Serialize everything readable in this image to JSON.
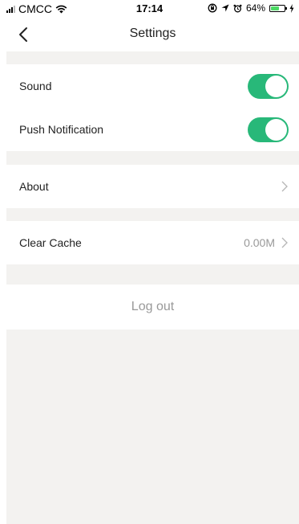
{
  "status_bar": {
    "carrier": "CMCC",
    "time": "17:14",
    "battery_percent": "64%",
    "battery_level": 0.64,
    "icons": [
      "signal-icon",
      "wifi-icon",
      "lock-rotation-icon",
      "location-icon",
      "alarm-icon",
      "battery-icon",
      "charging-icon"
    ]
  },
  "nav": {
    "title": "Settings",
    "back_icon": "chevron-left-icon"
  },
  "settings": {
    "sound": {
      "label": "Sound",
      "enabled": true
    },
    "push": {
      "label": "Push Notification",
      "enabled": true
    },
    "about": {
      "label": "About"
    },
    "cache": {
      "label": "Clear Cache",
      "value": "0.00M"
    },
    "logout": {
      "label": "Log out"
    }
  },
  "colors": {
    "toggle_on": "#28b879",
    "background": "#f3f2f0",
    "secondary_text": "#999999"
  }
}
